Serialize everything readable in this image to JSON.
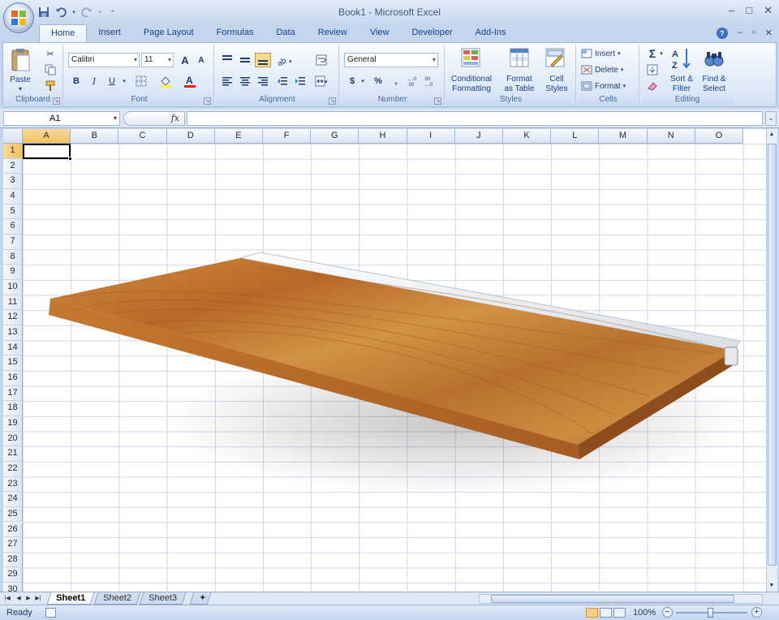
{
  "window": {
    "title": "Book1 - Microsoft Excel"
  },
  "qat": {
    "icons": [
      "save-icon",
      "undo-icon",
      "redo-icon",
      "customize-icon"
    ]
  },
  "tabs": [
    {
      "label": "Home",
      "active": true
    },
    {
      "label": "Insert"
    },
    {
      "label": "Page Layout"
    },
    {
      "label": "Formulas"
    },
    {
      "label": "Data"
    },
    {
      "label": "Review"
    },
    {
      "label": "View"
    },
    {
      "label": "Developer"
    },
    {
      "label": "Add-Ins"
    }
  ],
  "ribbon": {
    "clipboard": {
      "label": "Clipboard",
      "paste": "Paste"
    },
    "font": {
      "label": "Font",
      "family": "Calibri",
      "size": "11",
      "bold": "B",
      "italic": "I",
      "underline": "U",
      "grow": "A",
      "shrink": "A"
    },
    "alignment": {
      "label": "Alignment"
    },
    "number": {
      "label": "Number",
      "format": "General",
      "currency": "$",
      "percent": "%",
      "comma": ","
    },
    "styles": {
      "label": "Styles",
      "conditional_1": "Conditional",
      "conditional_2": "Formatting",
      "format_table_1": "Format",
      "format_table_2": "as Table",
      "cell_styles_1": "Cell",
      "cell_styles_2": "Styles"
    },
    "cells": {
      "label": "Cells",
      "insert": "Insert",
      "delete": "Delete",
      "format": "Format"
    },
    "editing": {
      "label": "Editing",
      "sort_1": "Sort &",
      "sort_2": "Filter",
      "find_1": "Find &",
      "find_2": "Select",
      "sigma": "Σ"
    }
  },
  "formula_bar": {
    "name_box": "A1",
    "fx": "fx",
    "value": ""
  },
  "grid": {
    "columns": [
      "A",
      "B",
      "C",
      "D",
      "E",
      "F",
      "G",
      "H",
      "I",
      "J",
      "K",
      "L",
      "M",
      "N",
      "O"
    ],
    "rows": [
      "1",
      "2",
      "3",
      "4",
      "5",
      "6",
      "7",
      "8",
      "9",
      "10",
      "11",
      "12",
      "13",
      "14",
      "15",
      "16",
      "17",
      "18",
      "19",
      "20",
      "21",
      "22",
      "23",
      "24",
      "25",
      "26",
      "27",
      "28",
      "29",
      "30"
    ],
    "selected_cell": "A1"
  },
  "sheets": [
    {
      "label": "Sheet1",
      "active": true
    },
    {
      "label": "Sheet2"
    },
    {
      "label": "Sheet3"
    }
  ],
  "status": {
    "text": "Ready",
    "zoom": "100%",
    "zoom_minus": "−",
    "zoom_plus": "+"
  },
  "colors": {
    "ribbon_text": "#15428b",
    "selected_header": "#f1c15f",
    "wood": "#c27a32"
  }
}
